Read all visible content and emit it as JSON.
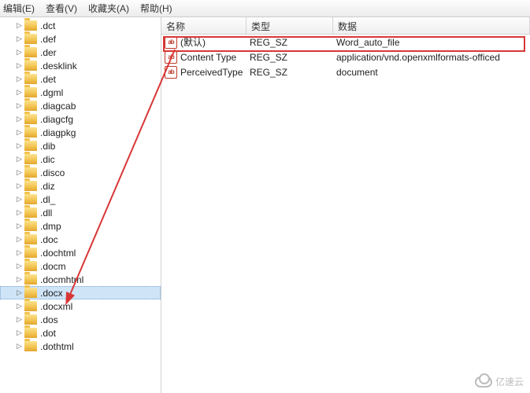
{
  "menu": {
    "edit": "编辑(E)",
    "view": "查看(V)",
    "favorites": "收藏夹(A)",
    "help": "帮助(H)"
  },
  "tree": {
    "items": [
      {
        "label": ".dct"
      },
      {
        "label": ".def"
      },
      {
        "label": ".der"
      },
      {
        "label": ".desklink"
      },
      {
        "label": ".det"
      },
      {
        "label": ".dgml"
      },
      {
        "label": ".diagcab"
      },
      {
        "label": ".diagcfg"
      },
      {
        "label": ".diagpkg"
      },
      {
        "label": ".dib"
      },
      {
        "label": ".dic"
      },
      {
        "label": ".disco"
      },
      {
        "label": ".diz"
      },
      {
        "label": ".dl_"
      },
      {
        "label": ".dll"
      },
      {
        "label": ".dmp"
      },
      {
        "label": ".doc"
      },
      {
        "label": ".dochtml"
      },
      {
        "label": ".docm"
      },
      {
        "label": ".docmhtml"
      },
      {
        "label": ".docx",
        "selected": true
      },
      {
        "label": ".docxml"
      },
      {
        "label": ".dos"
      },
      {
        "label": ".dot"
      },
      {
        "label": ".dothtml"
      }
    ]
  },
  "list": {
    "headers": {
      "name": "名称",
      "type": "类型",
      "data": "数据"
    },
    "rows": [
      {
        "name": "(默认)",
        "type": "REG_SZ",
        "data": "Word_auto_file"
      },
      {
        "name": "Content Type",
        "type": "REG_SZ",
        "data": "application/vnd.openxmlformats-officed"
      },
      {
        "name": "PerceivedType",
        "type": "REG_SZ",
        "data": "document"
      }
    ]
  },
  "watermark": "亿速云"
}
